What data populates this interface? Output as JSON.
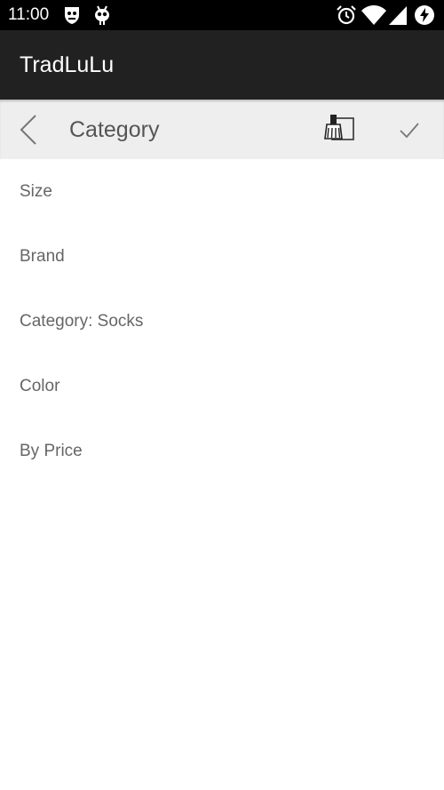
{
  "status_bar": {
    "time": "11:00",
    "left_icons": [
      "shield-face-icon",
      "alien-icon"
    ],
    "right_icons": [
      "alarm-icon",
      "wifi-icon",
      "signal-icon",
      "battery-charging-icon"
    ]
  },
  "app_bar": {
    "title": "TradLuLu",
    "background": "#212121"
  },
  "toolbar": {
    "title": "Category",
    "back_icon": "chevron-left-icon",
    "clear_icon": "broom-clear-icon",
    "confirm_icon": "checkmark-icon"
  },
  "filters": [
    {
      "label": "Size"
    },
    {
      "label": "Brand"
    },
    {
      "label": "Category: Socks"
    },
    {
      "label": "Color"
    },
    {
      "label": "By Price"
    }
  ],
  "colors": {
    "status_bar": "#000000",
    "toolbar": "#eeeeee",
    "text_secondary": "#666666"
  }
}
